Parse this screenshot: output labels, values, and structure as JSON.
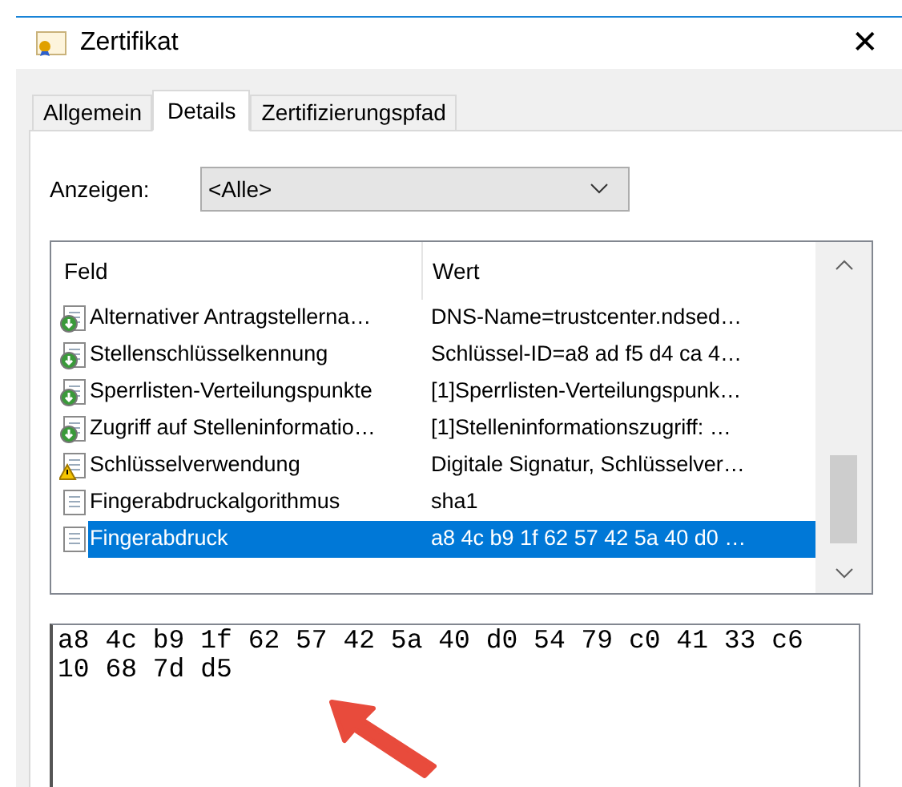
{
  "window": {
    "title": "Zertifikat",
    "close": "✕"
  },
  "tabs": [
    {
      "label": "Allgemein",
      "selected": false
    },
    {
      "label": "Details",
      "selected": true
    },
    {
      "label": "Zertifizierungspfad",
      "selected": false
    }
  ],
  "show": {
    "label": "Anzeigen:",
    "value": "<Alle>"
  },
  "table": {
    "columns": [
      "Feld",
      "Wert"
    ],
    "rows": [
      {
        "kind": "extension",
        "field": "Alternativer Antragstellerna…",
        "value": "DNS-Name=trustcenter.ndsed…",
        "selected": false
      },
      {
        "kind": "extension",
        "field": "Stellenschlüsselkennung",
        "value": "Schlüssel-ID=a8 ad f5 d4 ca 4…",
        "selected": false
      },
      {
        "kind": "extension",
        "field": "Sperrlisten-Verteilungspunkte",
        "value": "[1]Sperrlisten-Verteilungspunk…",
        "selected": false
      },
      {
        "kind": "extension",
        "field": "Zugriff auf Stelleninformatio…",
        "value": "[1]Stelleninformationszugriff: …",
        "selected": false
      },
      {
        "kind": "warning",
        "field": "Schlüsselverwendung",
        "value": "Digitale Signatur, Schlüsselver…",
        "selected": false
      },
      {
        "kind": "property",
        "field": "Fingerabdruckalgorithmus",
        "value": "sha1",
        "selected": false
      },
      {
        "kind": "property",
        "field": "Fingerabdruck",
        "value": "a8 4c b9 1f 62 57 42 5a 40 d0 …",
        "selected": true
      }
    ]
  },
  "detail": {
    "value": "a8 4c b9 1f 62 57 42 5a 40 d0 54 79 c0 41 33 c6 10 68 7d d5"
  }
}
